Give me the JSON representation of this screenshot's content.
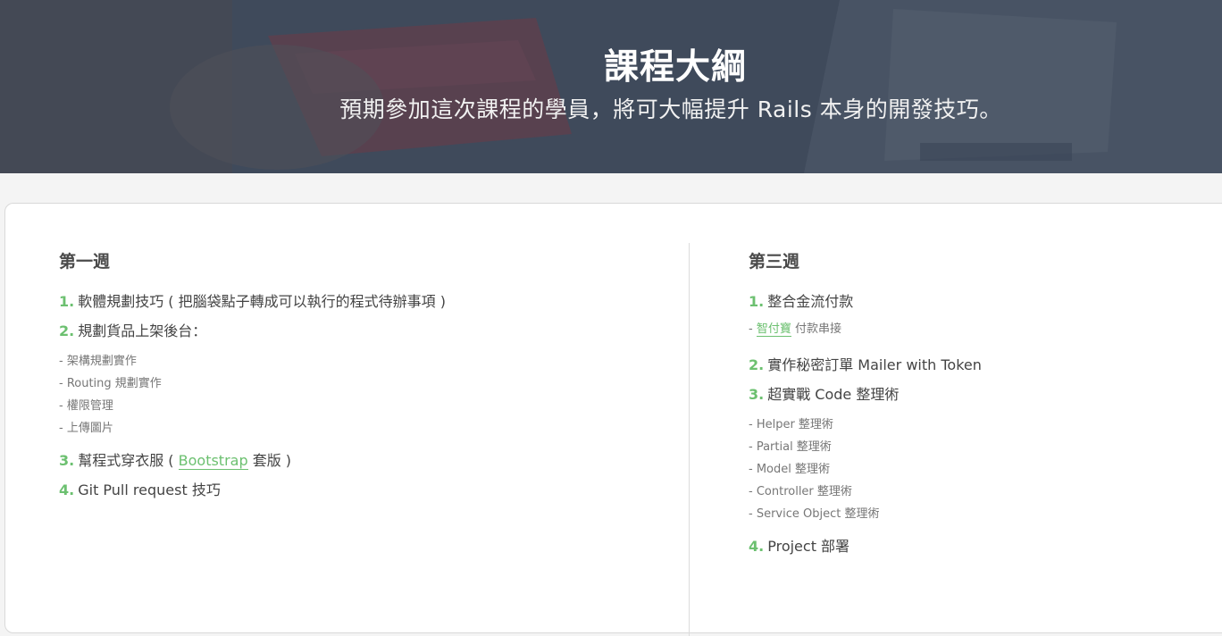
{
  "hero": {
    "title": "課程大綱",
    "subtitle": "預期參加這次課程的學員，將可大幅提升 Rails 本身的開發技巧。"
  },
  "week1": {
    "title": "第一週",
    "items": [
      {
        "num": "1.",
        "text": "軟體規劃技巧 ( 把腦袋點子轉成可以執行的程式待辦事項 )"
      },
      {
        "num": "2.",
        "text": "規劃貨品上架後台："
      },
      {
        "num": "3.",
        "pre": "幫程式穿衣服 ( ",
        "link": "Bootstrap",
        "post": " 套版 )"
      },
      {
        "num": "4.",
        "text": "Git Pull request 技巧"
      }
    ],
    "sub2": [
      "- 架構規劃實作",
      "- Routing 規劃實作",
      "- 權限管理",
      "- 上傳圖片"
    ]
  },
  "week3": {
    "title": "第三週",
    "items": [
      {
        "num": "1.",
        "text": "整合金流付款"
      },
      {
        "num": "2.",
        "text": "實作秘密訂單 Mailer with Token"
      },
      {
        "num": "3.",
        "text": "超實戰 Code 整理術"
      },
      {
        "num": "4.",
        "text": "Project 部署"
      }
    ],
    "sub1": {
      "dash": "- ",
      "link": "智付寶",
      "post": " 付款串接"
    },
    "sub3": [
      "- Helper 整理術",
      "- Partial 整理術",
      "- Model 整理術",
      "- Controller 整理術",
      "- Service Object 整理術"
    ]
  },
  "colors": {
    "accent": "#6cc070",
    "hero_overlay": "#374254"
  }
}
